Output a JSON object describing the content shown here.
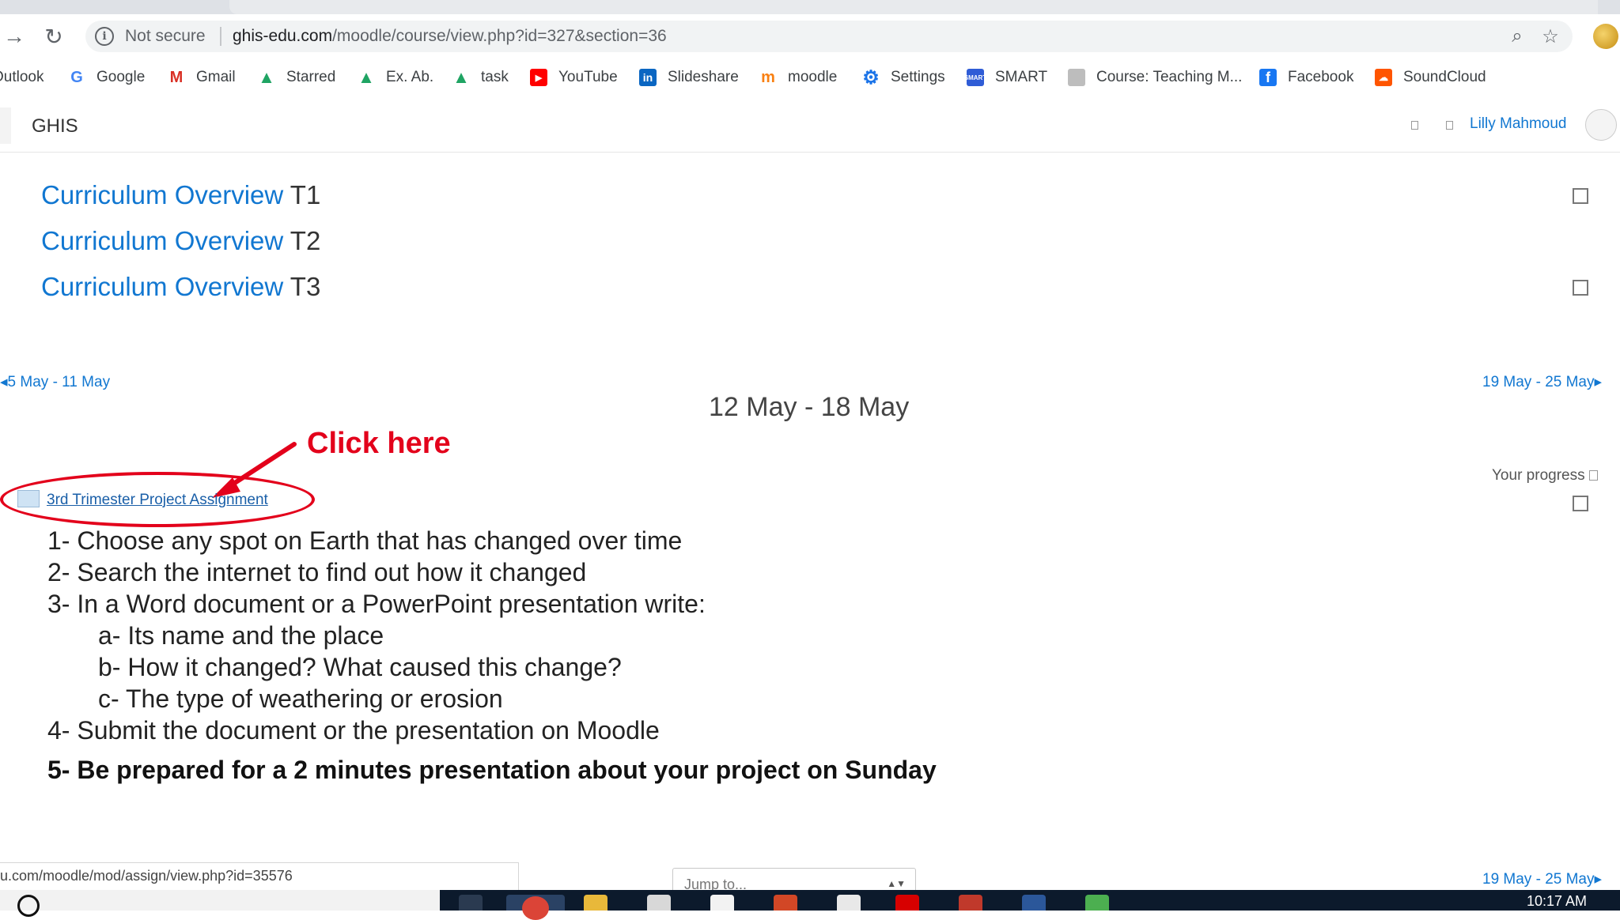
{
  "browser": {
    "security_label": "Not secure",
    "url_host": "ghis-edu.com",
    "url_path": "/moodle/course/view.php?id=327&section=36",
    "bookmarks": [
      {
        "label": "Outlook",
        "icon": "outlook-icon",
        "color": "#0078d4"
      },
      {
        "label": "Google",
        "icon": "google-icon",
        "color": "#4285f4"
      },
      {
        "label": "Gmail",
        "icon": "gmail-icon",
        "color": "#d93025"
      },
      {
        "label": "Starred",
        "icon": "google-drive-icon",
        "color": "#1fa463"
      },
      {
        "label": "Ex. Ab.",
        "icon": "google-drive-icon",
        "color": "#1fa463"
      },
      {
        "label": "task",
        "icon": "google-drive-icon",
        "color": "#1fa463"
      },
      {
        "label": "YouTube",
        "icon": "youtube-icon",
        "color": "#ff0000"
      },
      {
        "label": "Slideshare",
        "icon": "linkedin-icon",
        "color": "#0a66c2"
      },
      {
        "label": "moodle",
        "icon": "moodle-icon",
        "color": "#f98012"
      },
      {
        "label": "Settings",
        "icon": "gear-icon",
        "color": "#1a73e8"
      },
      {
        "label": "SMART",
        "icon": "smart-icon",
        "color": "#2f5cd6"
      },
      {
        "label": "Course: Teaching M...",
        "icon": "page-icon",
        "color": "#888888"
      },
      {
        "label": "Facebook",
        "icon": "facebook-icon",
        "color": "#1877f2"
      },
      {
        "label": "SoundCloud",
        "icon": "soundcloud-icon",
        "color": "#ff5500"
      }
    ]
  },
  "navbar": {
    "brand": "GHIS",
    "user_name": "Lilly Mahmoud"
  },
  "curriculum": [
    {
      "link": "Curriculum Overview",
      "term": "T1"
    },
    {
      "link": "Curriculum Overview",
      "term": "T2"
    },
    {
      "link": "Curriculum Overview",
      "term": "T3"
    }
  ],
  "section": {
    "prev_week": "5 May - 11 May",
    "next_week": "19 May - 25 May",
    "title": "12 May - 18 May",
    "progress_label": "Your progress",
    "assignment_link": "3rd Trimester Project Assignment",
    "annotation": "Click here",
    "steps": [
      "1- Choose any spot on Earth that has changed over time",
      "2- Search the internet to find out how it changed",
      "3- In a Word document or a PowerPoint presentation write:",
      "a- Its name and the place",
      "b- How it changed? What caused this change?",
      "c- The type of weathering or erosion",
      "4- Submit the document or the presentation on Moodle",
      "5- Be prepared for a 2 minutes presentation about your project on Sunday"
    ]
  },
  "footer": {
    "status_url": "u.com/moodle/mod/assign/view.php?id=35576",
    "jump_to": "Jump to...",
    "next_week": "19 May - 25 May"
  },
  "taskbar": {
    "clock": "10:17 AM"
  }
}
